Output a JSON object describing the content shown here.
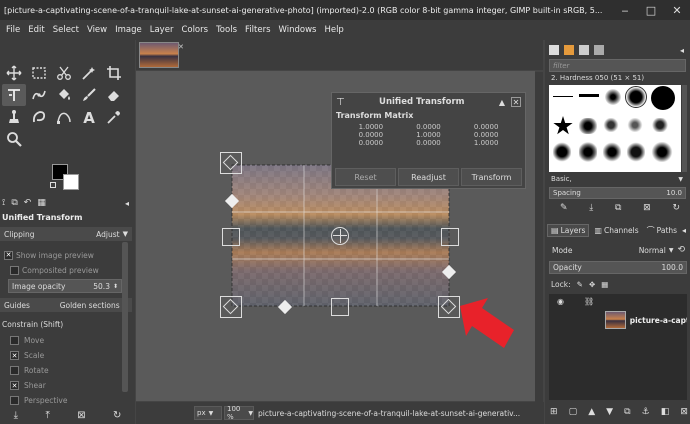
{
  "window": {
    "title": "[picture-a-captivating-scene-of-a-tranquil-lake-at-sunset-ai-generative-photo] (imported)-2.0 (RGB color 8-bit gamma integer, GIMP built-in sRGB, 5...",
    "minimize": "‒",
    "maximize": "□",
    "close": "✕"
  },
  "menu": [
    "File",
    "Edit",
    "Select",
    "View",
    "Image",
    "Layer",
    "Colors",
    "Tools",
    "Filters",
    "Windows",
    "Help"
  ],
  "tool_options": {
    "title": "Unified Transform",
    "clipping_label": "Clipping",
    "clipping_value": "Adjust",
    "show_preview": "Show image preview",
    "composited_preview": "Composited preview",
    "opacity_label": "Image opacity",
    "opacity_value": "50.3",
    "guides_label": "Guides",
    "guides_value": "Golden sections",
    "constrain_label": "Constrain (Shift)",
    "constraints": [
      {
        "label": "Move",
        "checked": false
      },
      {
        "label": "Scale",
        "checked": true
      },
      {
        "label": "Rotate",
        "checked": false
      },
      {
        "label": "Shear",
        "checked": true
      },
      {
        "label": "Perspective",
        "checked": false
      }
    ]
  },
  "transform_dialog": {
    "title": "Unified Transform",
    "matrix_label": "Transform Matrix",
    "matrix": [
      [
        "1.0000",
        "0.0000",
        "0.0000"
      ],
      [
        "0.0000",
        "1.0000",
        "0.0000"
      ],
      [
        "0.0000",
        "0.0000",
        "1.0000"
      ]
    ],
    "reset": "Reset",
    "readjust": "Readjust",
    "transform": "Transform"
  },
  "status": {
    "unit": "px",
    "zoom": "100 %",
    "filename": "picture-a-captivating-scene-of-a-tranquil-lake-at-sunset-ai-generativ..."
  },
  "brushes": {
    "filter_placeholder": "filter",
    "current": "2. Hardness 050 (51 × 51)",
    "preset": "Basic,",
    "spacing_label": "Spacing",
    "spacing_value": "10.0"
  },
  "layers": {
    "tabs": [
      "Layers",
      "Channels",
      "Paths"
    ],
    "mode_label": "Mode",
    "mode_value": "Normal",
    "opacity_label": "Opacity",
    "opacity_value": "100.0",
    "lock_label": "Lock:",
    "layer_name": "picture-a-captiv"
  },
  "colors": {
    "accent_red": "#e8222a",
    "panel_bg": "#3c3c3c",
    "canvas_bg": "#5a5a5a"
  }
}
